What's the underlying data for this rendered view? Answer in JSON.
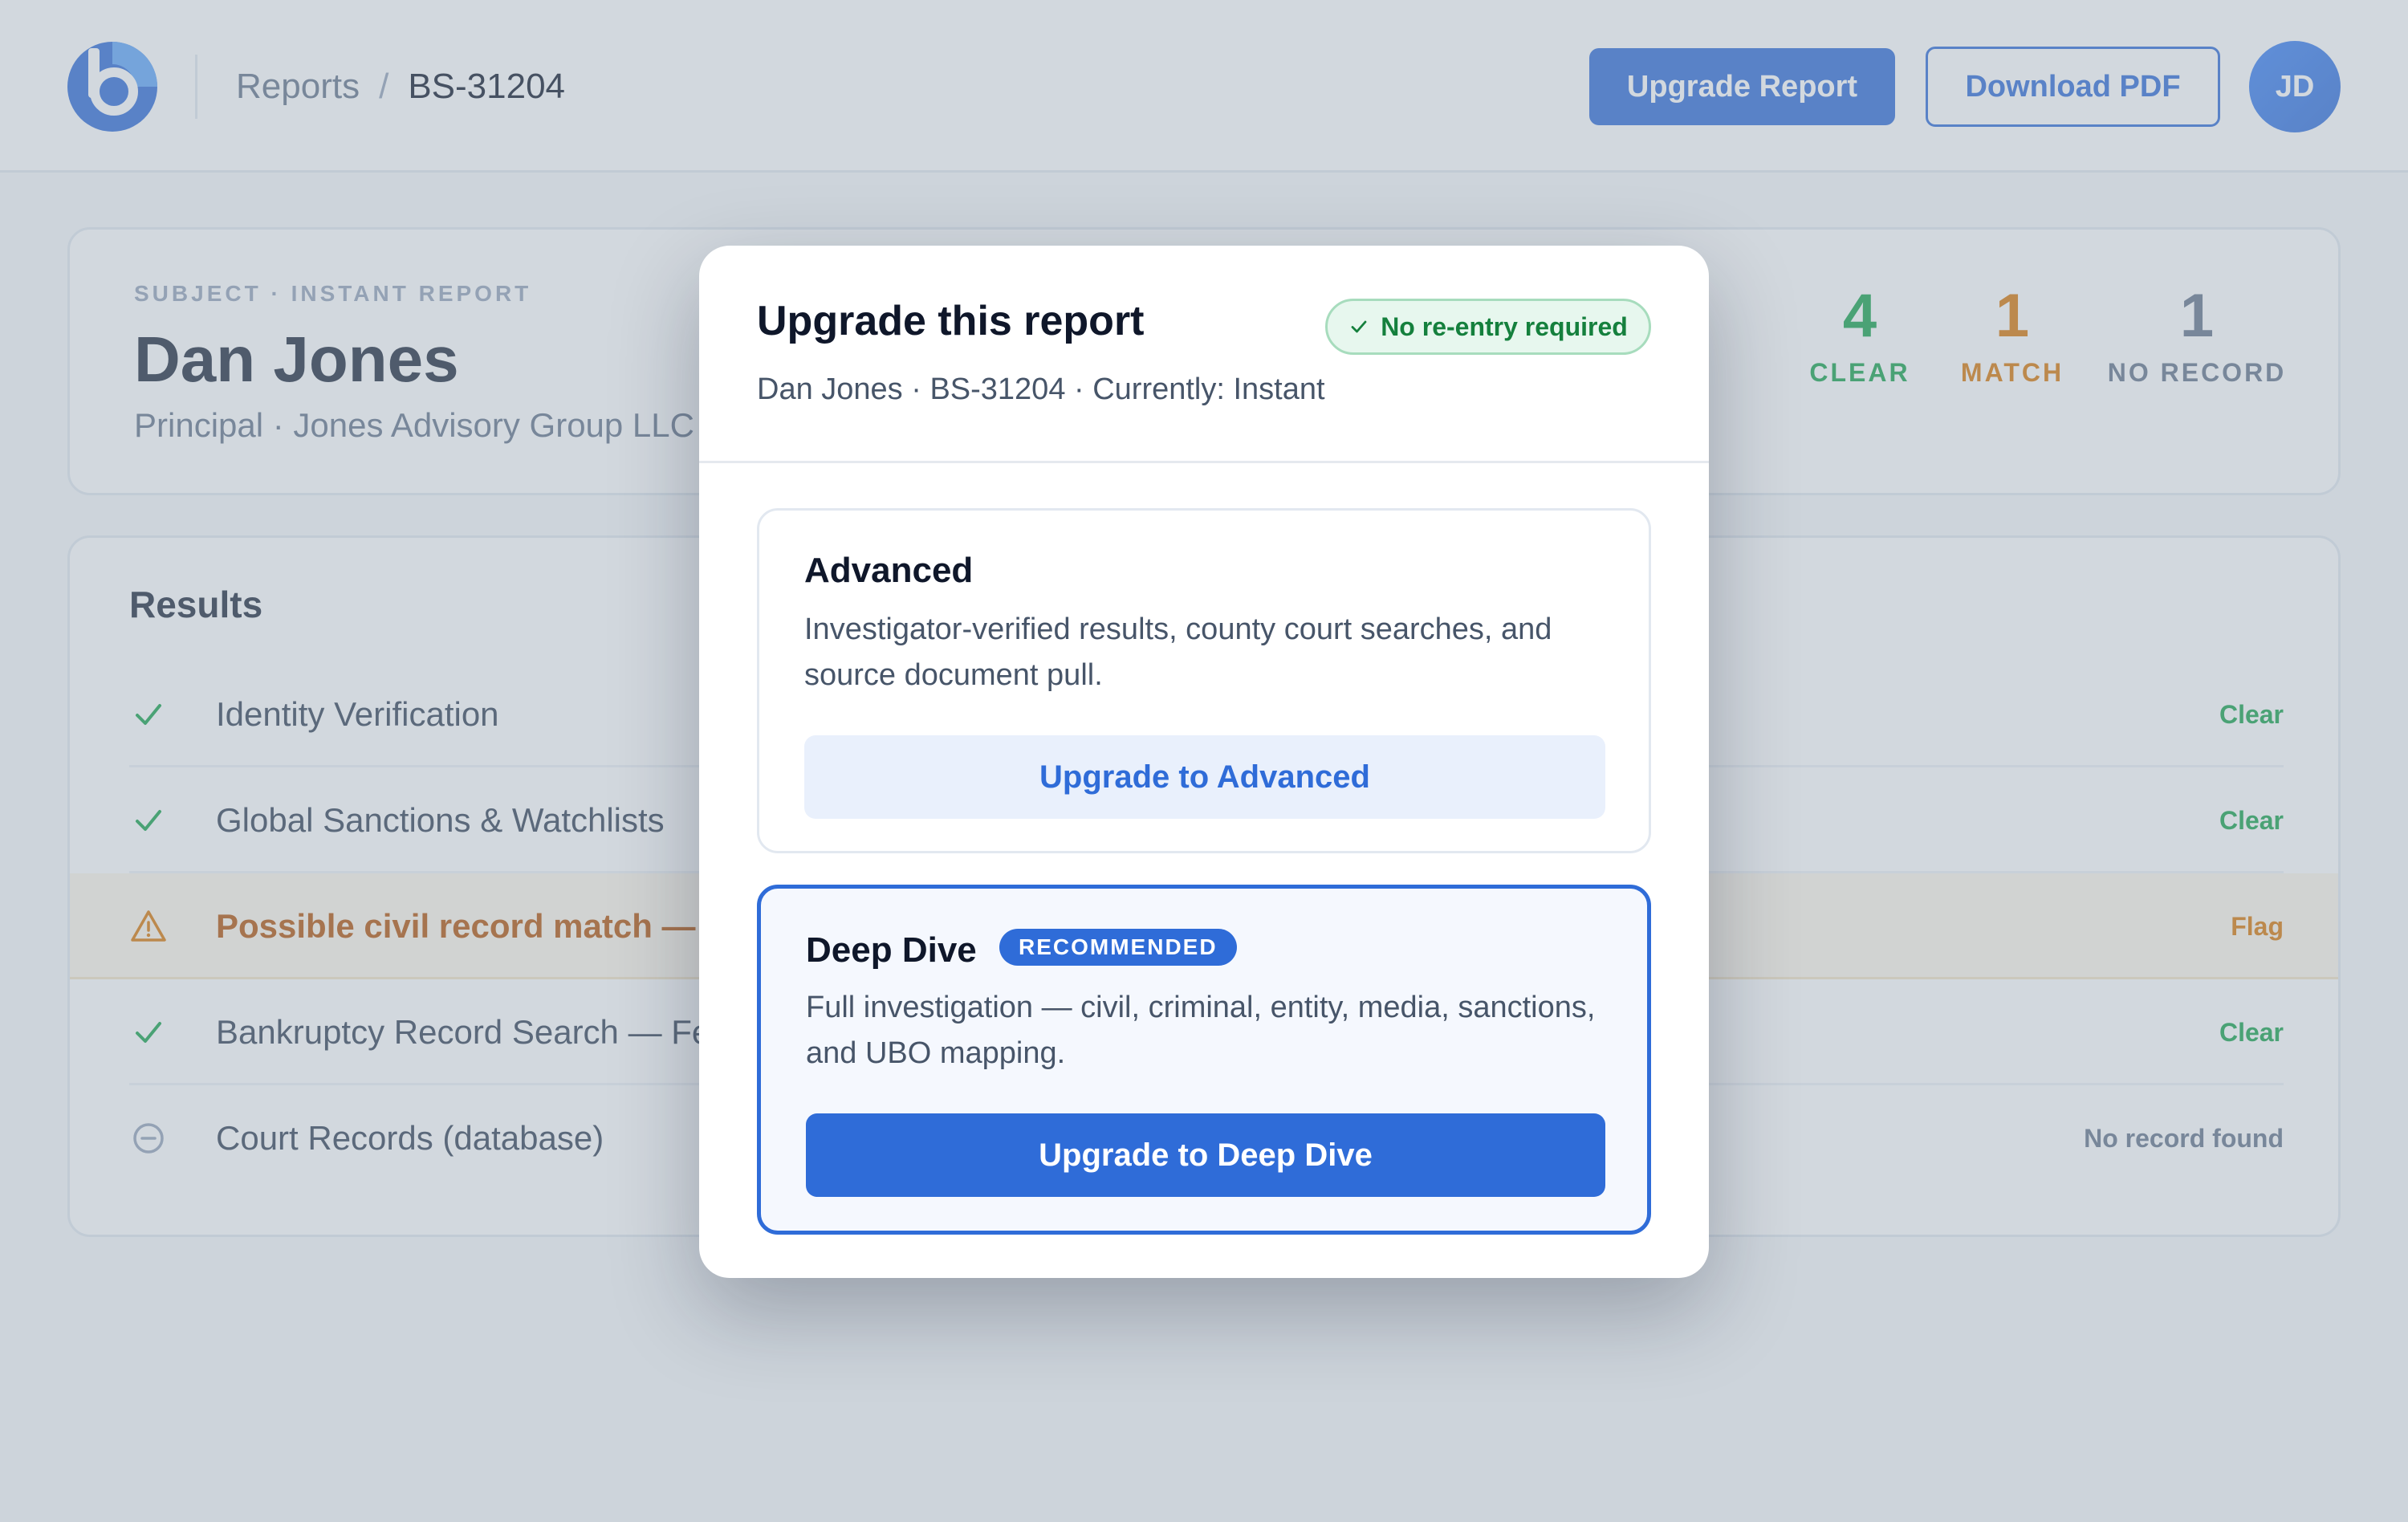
{
  "header": {
    "breadcrumb_parent": "Reports",
    "breadcrumb_separator": "/",
    "breadcrumb_current": "BS-31204",
    "upgrade_report_label": "Upgrade Report",
    "download_pdf_label": "Download PDF",
    "avatar_initials": "JD"
  },
  "subject": {
    "eyebrow": "SUBJECT · INSTANT REPORT",
    "name": "Dan Jones",
    "role": "Principal · Jones Advisory Group LLC ·",
    "stats": [
      {
        "value": "4",
        "label": "CLEAR"
      },
      {
        "value": "1",
        "label": "MATCH"
      },
      {
        "value": "1",
        "label": "NO RECORD"
      }
    ]
  },
  "results": {
    "title": "Results",
    "rows": [
      {
        "label": "Identity Verification",
        "status": "Clear",
        "icon": "check-icon"
      },
      {
        "label": "Global Sanctions & Watchlists",
        "status": "Clear",
        "icon": "check-icon"
      },
      {
        "label": "Possible civil record match — re",
        "status": "Flag",
        "icon": "warning-icon"
      },
      {
        "label": "Bankruptcy Record Search — Fec",
        "status": "Clear",
        "icon": "check-icon"
      },
      {
        "label": "Court Records (database)",
        "status": "No record found",
        "icon": "minus-circle-icon"
      }
    ]
  },
  "modal": {
    "title": "Upgrade this report",
    "pill": "No re-entry required",
    "subtitle": "Dan Jones · BS-31204 · Currently: Instant",
    "plans": [
      {
        "name": "Advanced",
        "description": "Investigator-verified results, county court searches, and source document pull.",
        "button": "Upgrade to Advanced"
      },
      {
        "name": "Deep Dive",
        "badge": "RECOMMENDED",
        "description": "Full investigation — civil, criminal, entity, media, sanctions, and UBO mapping.",
        "button": "Upgrade to Deep Dive"
      }
    ]
  },
  "colors": {
    "brand": "#2f6cd8",
    "clear": "#16a34a",
    "flag": "#d97706",
    "muted": "#64748b"
  }
}
